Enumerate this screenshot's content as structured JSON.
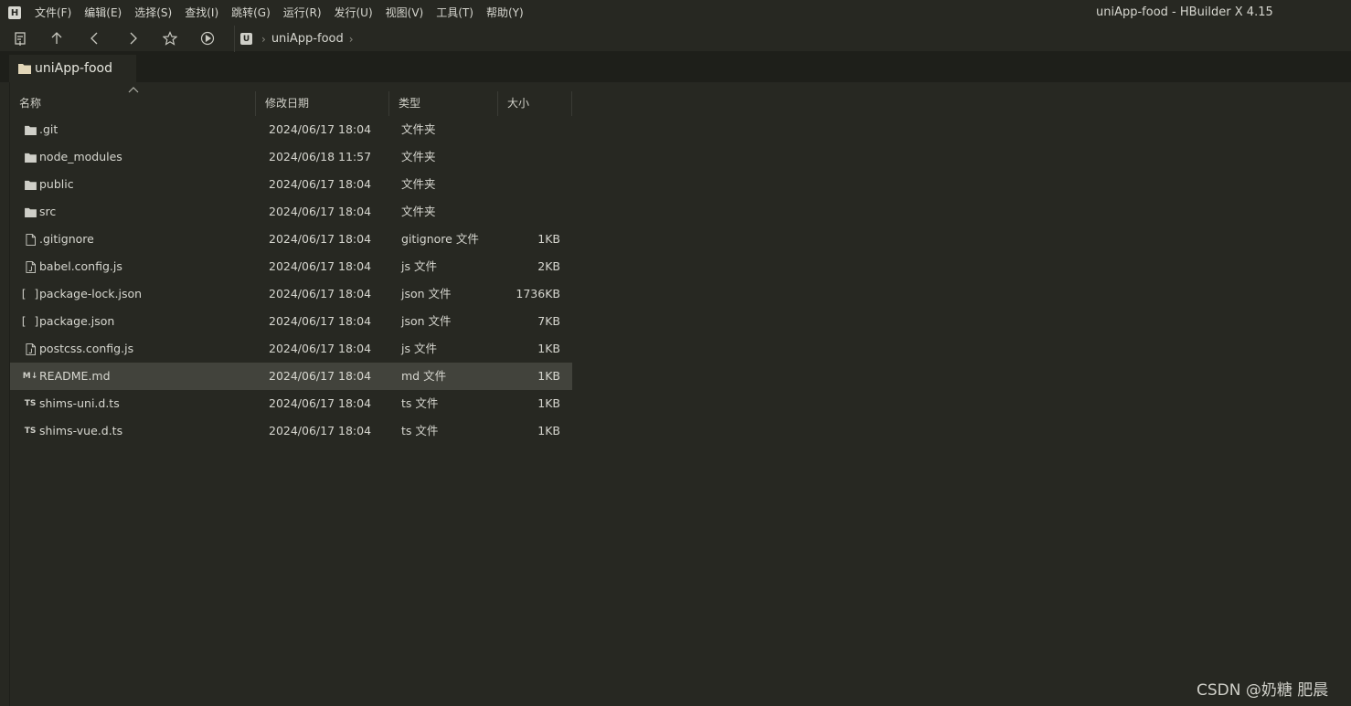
{
  "menubar": {
    "logo": "H",
    "items": [
      "文件(F)",
      "编辑(E)",
      "选择(S)",
      "查找(I)",
      "跳转(G)",
      "运行(R)",
      "发行(U)",
      "视图(V)",
      "工具(T)",
      "帮助(Y)"
    ]
  },
  "window_title": "uniApp-food - HBuilder X 4.15",
  "toolbar": {
    "icons": [
      "new-file-icon",
      "arrow-up-icon",
      "chevron-left-icon",
      "chevron-right-icon",
      "star-icon",
      "play-circle-icon"
    ]
  },
  "breadcrumb": {
    "logo": "U",
    "project": "uniApp-food"
  },
  "tab": {
    "label": "uniApp-food"
  },
  "columns": {
    "name": "名称",
    "date": "修改日期",
    "type": "类型",
    "size": "大小"
  },
  "files": [
    {
      "icon": "folder",
      "name": ".git",
      "date": "2024/06/17 18:04",
      "type": "文件夹",
      "size": ""
    },
    {
      "icon": "folder",
      "name": "node_modules",
      "date": "2024/06/18 11:57",
      "type": "文件夹",
      "size": ""
    },
    {
      "icon": "folder",
      "name": "public",
      "date": "2024/06/17 18:04",
      "type": "文件夹",
      "size": ""
    },
    {
      "icon": "folder",
      "name": "src",
      "date": "2024/06/17 18:04",
      "type": "文件夹",
      "size": ""
    },
    {
      "icon": "file",
      "name": ".gitignore",
      "date": "2024/06/17 18:04",
      "type": "gitignore 文件",
      "size": "1KB"
    },
    {
      "icon": "js",
      "name": "babel.config.js",
      "date": "2024/06/17 18:04",
      "type": "js 文件",
      "size": "2KB"
    },
    {
      "icon": "json",
      "name": "package-lock.json",
      "date": "2024/06/17 18:04",
      "type": "json 文件",
      "size": "1736KB"
    },
    {
      "icon": "json",
      "name": "package.json",
      "date": "2024/06/17 18:04",
      "type": "json 文件",
      "size": "7KB"
    },
    {
      "icon": "js",
      "name": "postcss.config.js",
      "date": "2024/06/17 18:04",
      "type": "js 文件",
      "size": "1KB"
    },
    {
      "icon": "md",
      "name": "README.md",
      "date": "2024/06/17 18:04",
      "type": "md 文件",
      "size": "1KB",
      "selected": true
    },
    {
      "icon": "ts",
      "name": "shims-uni.d.ts",
      "date": "2024/06/17 18:04",
      "type": "ts 文件",
      "size": "1KB"
    },
    {
      "icon": "ts",
      "name": "shims-vue.d.ts",
      "date": "2024/06/17 18:04",
      "type": "ts 文件",
      "size": "1KB"
    }
  ],
  "icon_labels": {
    "json": "[ ]",
    "md": "M↓",
    "ts": "TS"
  },
  "watermark": "CSDN @奶糖 肥晨",
  "colors": {
    "background": "#272822",
    "tabbar": "#1e1f1a",
    "selected_row": "#42433c",
    "text": "#d7d7d0"
  }
}
